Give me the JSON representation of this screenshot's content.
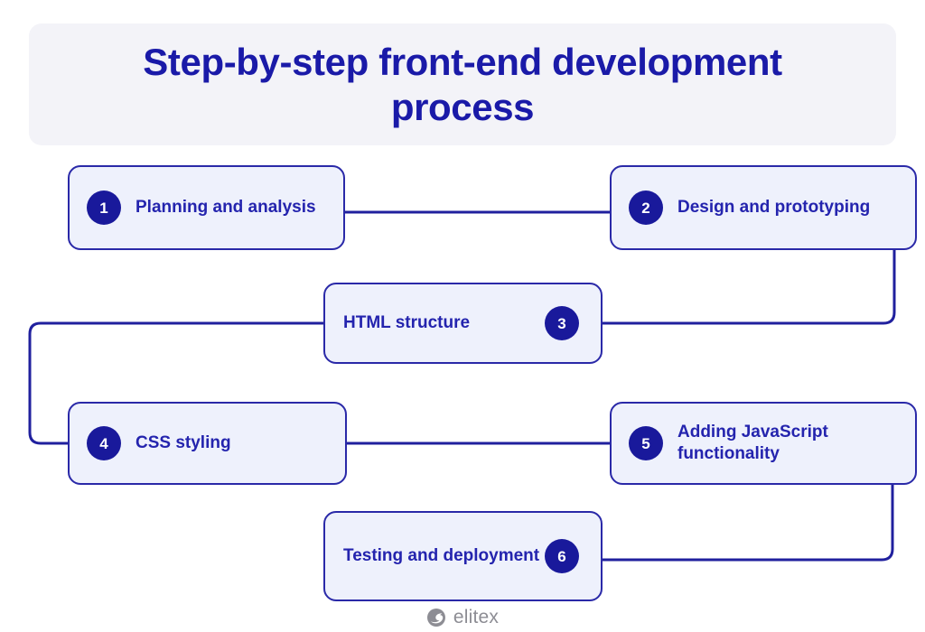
{
  "title": {
    "text": "Step-by-step front-end development process"
  },
  "colors": {
    "banner_bg": "#f3f3f8",
    "box_fill": "#eef1fc",
    "box_border": "#2a29a8",
    "badge_fill": "#19199b",
    "badge_text": "#ffffff",
    "label_text": "#2424ae",
    "title_text": "#1a1aa8",
    "connector": "#20209e",
    "logo_gray": "#8d8d94"
  },
  "steps": [
    {
      "number": "1",
      "label": "Planning and analysis",
      "badge_side": "left"
    },
    {
      "number": "2",
      "label": "Design and prototyping",
      "badge_side": "left"
    },
    {
      "number": "3",
      "label": "HTML structure",
      "badge_side": "right"
    },
    {
      "number": "4",
      "label": "CSS styling",
      "badge_side": "left"
    },
    {
      "number": "5",
      "label": "Adding JavaScript functionality",
      "badge_side": "left"
    },
    {
      "number": "6",
      "label": "Testing and deployment",
      "badge_side": "right"
    }
  ],
  "footer": {
    "brand": "elitex",
    "logo_icon": "elitex-swirl-icon"
  },
  "chart_data": {
    "type": "diagram",
    "diagram_kind": "serpentine-flowchart",
    "title": "Step-by-step front-end development process",
    "node_count": 6,
    "nodes": [
      {
        "id": 1,
        "number": "1",
        "label": "Planning and analysis",
        "row": 1,
        "column": "left",
        "badge_side": "left"
      },
      {
        "id": 2,
        "number": "2",
        "label": "Design and prototyping",
        "row": 1,
        "column": "right",
        "badge_side": "left"
      },
      {
        "id": 3,
        "number": "3",
        "label": "HTML structure",
        "row": 2,
        "column": "center",
        "badge_side": "right"
      },
      {
        "id": 4,
        "number": "4",
        "label": "CSS styling",
        "row": 3,
        "column": "left",
        "badge_side": "left"
      },
      {
        "id": 5,
        "number": "5",
        "label": "Adding JavaScript functionality",
        "row": 3,
        "column": "right",
        "badge_side": "left"
      },
      {
        "id": 6,
        "number": "6",
        "label": "Testing and deployment",
        "row": 4,
        "column": "center",
        "badge_side": "right"
      }
    ],
    "edges": [
      {
        "from": 1,
        "to": 2,
        "style": "straight-horizontal"
      },
      {
        "from": 2,
        "to": 3,
        "style": "elbow-right-down-left"
      },
      {
        "from": 3,
        "to": 4,
        "style": "elbow-left-down-right"
      },
      {
        "from": 4,
        "to": 5,
        "style": "straight-horizontal"
      },
      {
        "from": 5,
        "to": 6,
        "style": "elbow-right-down-left"
      }
    ],
    "legend": [],
    "grid": false
  }
}
